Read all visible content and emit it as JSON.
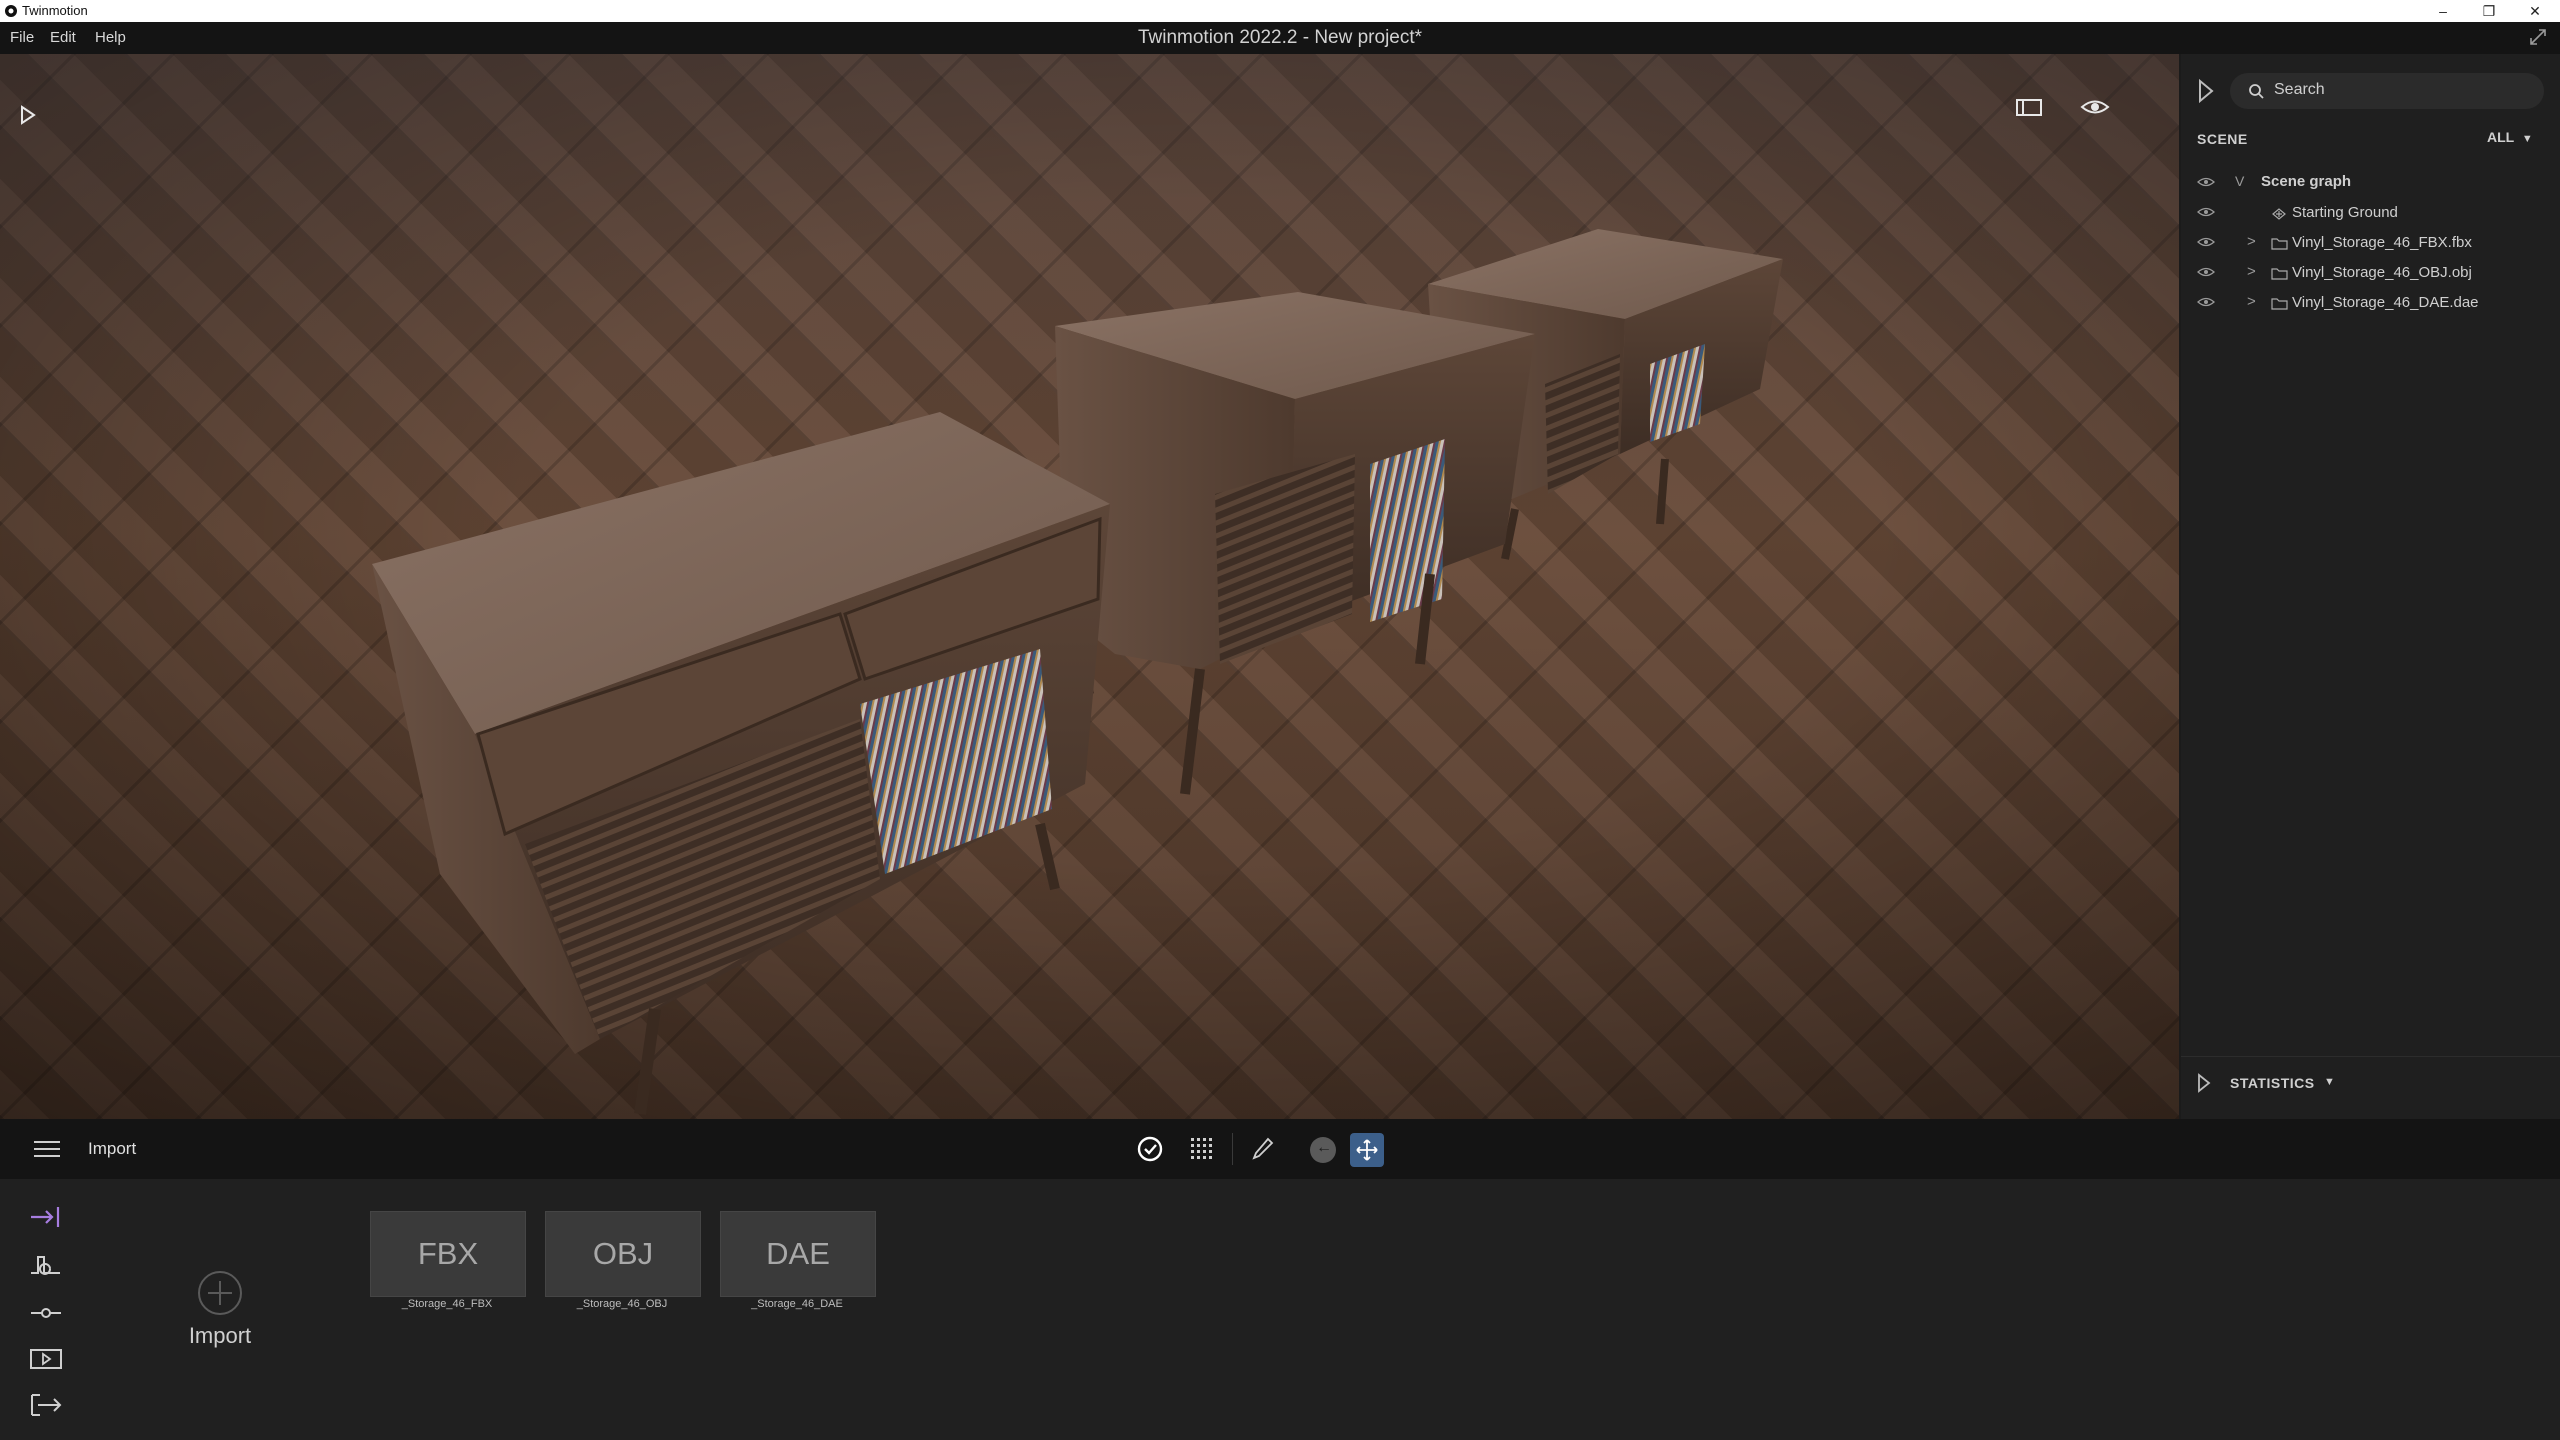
{
  "os_window": {
    "title": "Twinmotion",
    "controls": {
      "minimize": "–",
      "restore": "❐",
      "close": "✕"
    }
  },
  "app": {
    "title": "Twinmotion 2022.2 - New project*",
    "menu": [
      "File",
      "Edit",
      "Help"
    ]
  },
  "viewport": {
    "icons": [
      "play-icon",
      "panel-icon",
      "eye-icon"
    ]
  },
  "scene_panel": {
    "search_placeholder": "Search",
    "section_label": "SCENE",
    "filter_label": "ALL",
    "tree": [
      {
        "label": "Scene graph",
        "icon": "chevron-down-icon"
      },
      {
        "label": "Starting Ground",
        "icon": "ground-icon"
      },
      {
        "label": "Vinyl_Storage_46_FBX.fbx",
        "icon": "folder-icon"
      },
      {
        "label": "Vinyl_Storage_46_OBJ.obj",
        "icon": "folder-icon"
      },
      {
        "label": "Vinyl_Storage_46_DAE.dae",
        "icon": "folder-icon"
      }
    ],
    "statistics_label": "STATISTICS"
  },
  "bottom_bar": {
    "mode_label": "Import",
    "tools": [
      "select-icon",
      "grid-snap-icon",
      "eyedropper-icon",
      "back-icon",
      "move-icon"
    ]
  },
  "import_panel": {
    "side_tabs": [
      "import-tab-icon",
      "context-icon",
      "settings-icon",
      "media-icon",
      "export-icon"
    ],
    "import_button_label": "Import",
    "items": [
      {
        "format": "FBX",
        "caption": "_Storage_46_FBX"
      },
      {
        "format": "OBJ",
        "caption": "_Storage_46_OBJ"
      },
      {
        "format": "DAE",
        "caption": "_Storage_46_DAE"
      }
    ]
  },
  "colors": {
    "accent_purple": "#a77de0",
    "accent_blue": "#3c5f8a",
    "panel_bg": "#1f1f1f"
  }
}
